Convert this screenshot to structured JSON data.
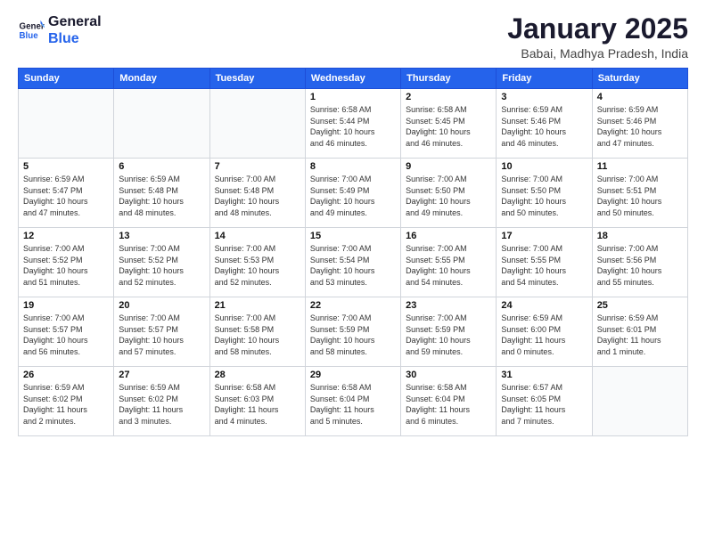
{
  "header": {
    "logo_general": "General",
    "logo_blue": "Blue",
    "month_title": "January 2025",
    "location": "Babai, Madhya Pradesh, India"
  },
  "days_of_week": [
    "Sunday",
    "Monday",
    "Tuesday",
    "Wednesday",
    "Thursday",
    "Friday",
    "Saturday"
  ],
  "weeks": [
    [
      {
        "day": "",
        "info": ""
      },
      {
        "day": "",
        "info": ""
      },
      {
        "day": "",
        "info": ""
      },
      {
        "day": "1",
        "info": "Sunrise: 6:58 AM\nSunset: 5:44 PM\nDaylight: 10 hours\nand 46 minutes."
      },
      {
        "day": "2",
        "info": "Sunrise: 6:58 AM\nSunset: 5:45 PM\nDaylight: 10 hours\nand 46 minutes."
      },
      {
        "day": "3",
        "info": "Sunrise: 6:59 AM\nSunset: 5:46 PM\nDaylight: 10 hours\nand 46 minutes."
      },
      {
        "day": "4",
        "info": "Sunrise: 6:59 AM\nSunset: 5:46 PM\nDaylight: 10 hours\nand 47 minutes."
      }
    ],
    [
      {
        "day": "5",
        "info": "Sunrise: 6:59 AM\nSunset: 5:47 PM\nDaylight: 10 hours\nand 47 minutes."
      },
      {
        "day": "6",
        "info": "Sunrise: 6:59 AM\nSunset: 5:48 PM\nDaylight: 10 hours\nand 48 minutes."
      },
      {
        "day": "7",
        "info": "Sunrise: 7:00 AM\nSunset: 5:48 PM\nDaylight: 10 hours\nand 48 minutes."
      },
      {
        "day": "8",
        "info": "Sunrise: 7:00 AM\nSunset: 5:49 PM\nDaylight: 10 hours\nand 49 minutes."
      },
      {
        "day": "9",
        "info": "Sunrise: 7:00 AM\nSunset: 5:50 PM\nDaylight: 10 hours\nand 49 minutes."
      },
      {
        "day": "10",
        "info": "Sunrise: 7:00 AM\nSunset: 5:50 PM\nDaylight: 10 hours\nand 50 minutes."
      },
      {
        "day": "11",
        "info": "Sunrise: 7:00 AM\nSunset: 5:51 PM\nDaylight: 10 hours\nand 50 minutes."
      }
    ],
    [
      {
        "day": "12",
        "info": "Sunrise: 7:00 AM\nSunset: 5:52 PM\nDaylight: 10 hours\nand 51 minutes."
      },
      {
        "day": "13",
        "info": "Sunrise: 7:00 AM\nSunset: 5:52 PM\nDaylight: 10 hours\nand 52 minutes."
      },
      {
        "day": "14",
        "info": "Sunrise: 7:00 AM\nSunset: 5:53 PM\nDaylight: 10 hours\nand 52 minutes."
      },
      {
        "day": "15",
        "info": "Sunrise: 7:00 AM\nSunset: 5:54 PM\nDaylight: 10 hours\nand 53 minutes."
      },
      {
        "day": "16",
        "info": "Sunrise: 7:00 AM\nSunset: 5:55 PM\nDaylight: 10 hours\nand 54 minutes."
      },
      {
        "day": "17",
        "info": "Sunrise: 7:00 AM\nSunset: 5:55 PM\nDaylight: 10 hours\nand 54 minutes."
      },
      {
        "day": "18",
        "info": "Sunrise: 7:00 AM\nSunset: 5:56 PM\nDaylight: 10 hours\nand 55 minutes."
      }
    ],
    [
      {
        "day": "19",
        "info": "Sunrise: 7:00 AM\nSunset: 5:57 PM\nDaylight: 10 hours\nand 56 minutes."
      },
      {
        "day": "20",
        "info": "Sunrise: 7:00 AM\nSunset: 5:57 PM\nDaylight: 10 hours\nand 57 minutes."
      },
      {
        "day": "21",
        "info": "Sunrise: 7:00 AM\nSunset: 5:58 PM\nDaylight: 10 hours\nand 58 minutes."
      },
      {
        "day": "22",
        "info": "Sunrise: 7:00 AM\nSunset: 5:59 PM\nDaylight: 10 hours\nand 58 minutes."
      },
      {
        "day": "23",
        "info": "Sunrise: 7:00 AM\nSunset: 5:59 PM\nDaylight: 10 hours\nand 59 minutes."
      },
      {
        "day": "24",
        "info": "Sunrise: 6:59 AM\nSunset: 6:00 PM\nDaylight: 11 hours\nand 0 minutes."
      },
      {
        "day": "25",
        "info": "Sunrise: 6:59 AM\nSunset: 6:01 PM\nDaylight: 11 hours\nand 1 minute."
      }
    ],
    [
      {
        "day": "26",
        "info": "Sunrise: 6:59 AM\nSunset: 6:02 PM\nDaylight: 11 hours\nand 2 minutes."
      },
      {
        "day": "27",
        "info": "Sunrise: 6:59 AM\nSunset: 6:02 PM\nDaylight: 11 hours\nand 3 minutes."
      },
      {
        "day": "28",
        "info": "Sunrise: 6:58 AM\nSunset: 6:03 PM\nDaylight: 11 hours\nand 4 minutes."
      },
      {
        "day": "29",
        "info": "Sunrise: 6:58 AM\nSunset: 6:04 PM\nDaylight: 11 hours\nand 5 minutes."
      },
      {
        "day": "30",
        "info": "Sunrise: 6:58 AM\nSunset: 6:04 PM\nDaylight: 11 hours\nand 6 minutes."
      },
      {
        "day": "31",
        "info": "Sunrise: 6:57 AM\nSunset: 6:05 PM\nDaylight: 11 hours\nand 7 minutes."
      },
      {
        "day": "",
        "info": ""
      }
    ]
  ]
}
